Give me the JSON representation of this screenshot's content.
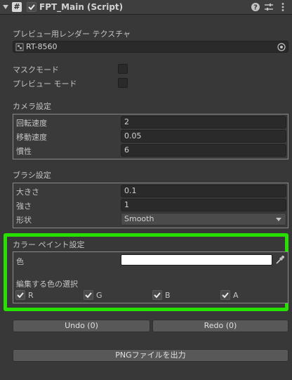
{
  "header": {
    "script_icon": "#",
    "title": "FPT_Main (Script)",
    "enabled": true,
    "icons": [
      "help-icon",
      "presets-icon",
      "context-menu-icon"
    ]
  },
  "texture": {
    "label": "プレビュー用レンダー テクスチャ",
    "value": "RT-8560"
  },
  "toggles": [
    {
      "label": "マスクモード",
      "checked": false
    },
    {
      "label": "プレビュー モード",
      "checked": false
    }
  ],
  "camera": {
    "title": "カメラ設定",
    "rows": [
      {
        "label": "回転速度",
        "value": "2"
      },
      {
        "label": "移動速度",
        "value": "0.05"
      },
      {
        "label": "慣性",
        "value": "6"
      }
    ]
  },
  "brush": {
    "title": "ブラシ設定",
    "rows": [
      {
        "label": "大きさ",
        "value": "0.1"
      },
      {
        "label": "強さ",
        "value": "1"
      }
    ],
    "shape_label": "形状",
    "shape_value": "Smooth"
  },
  "color_paint": {
    "title": "カラー ペイント設定",
    "color_label": "色",
    "color_value": "#ffffff",
    "channel_title": "編集する色の選択",
    "channels": [
      {
        "label": "R",
        "checked": true
      },
      {
        "label": "G",
        "checked": true
      },
      {
        "label": "B",
        "checked": true
      },
      {
        "label": "A",
        "checked": true
      }
    ],
    "highlight_color": "#27e000"
  },
  "actions": {
    "undo": "Undo (0)",
    "redo": "Redo (0)",
    "export": "PNGファイルを出力"
  }
}
